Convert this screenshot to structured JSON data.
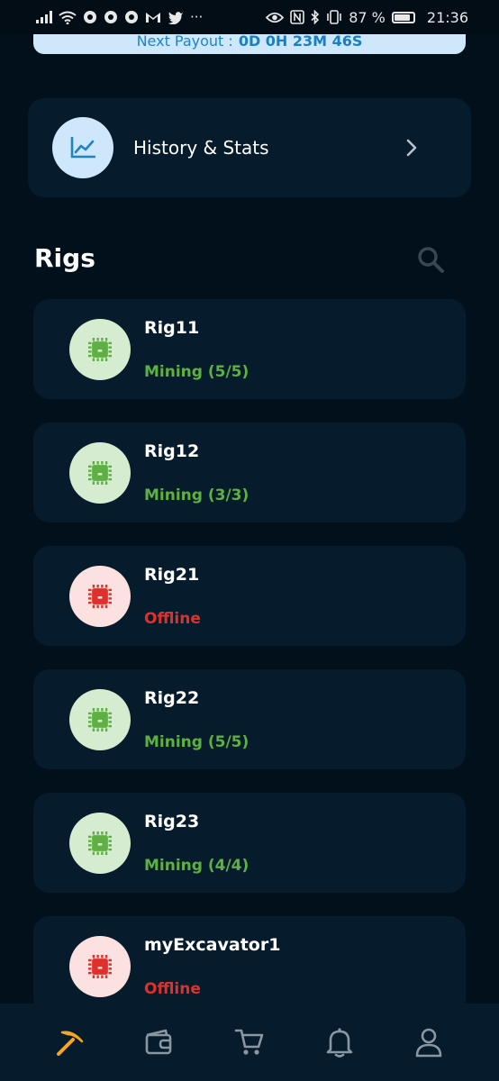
{
  "status_bar": {
    "battery_text": "87 %",
    "time": "21:36",
    "more": "···"
  },
  "payout": {
    "label": "Next Payout :",
    "value": "0D 0H 23M 46S"
  },
  "history": {
    "label": "History & Stats"
  },
  "rigs": {
    "title": "Rigs",
    "items": [
      {
        "name": "Rig11",
        "status": "Mining (5/5)",
        "state": "mining"
      },
      {
        "name": "Rig12",
        "status": "Mining (3/3)",
        "state": "mining"
      },
      {
        "name": "Rig21",
        "status": "Offline",
        "state": "offline"
      },
      {
        "name": "Rig22",
        "status": "Mining (5/5)",
        "state": "mining"
      },
      {
        "name": "Rig23",
        "status": "Mining (4/4)",
        "state": "mining"
      },
      {
        "name": "myExcavator1",
        "status": "Offline",
        "state": "offline"
      }
    ]
  },
  "colors": {
    "background": "#02101c",
    "card": "#061b2c",
    "mining": "#5fb043",
    "mining_bg": "#d5ecd0",
    "offline": "#e0302b",
    "offline_bg": "#fbe2e1",
    "accent": "#f5a623",
    "nav_icon": "#8a96a0"
  },
  "nav": {
    "items": [
      {
        "icon": "pickaxe-icon",
        "active": true
      },
      {
        "icon": "wallet-icon",
        "active": false
      },
      {
        "icon": "cart-icon",
        "active": false
      },
      {
        "icon": "bell-icon",
        "active": false
      },
      {
        "icon": "user-icon",
        "active": false
      }
    ]
  }
}
